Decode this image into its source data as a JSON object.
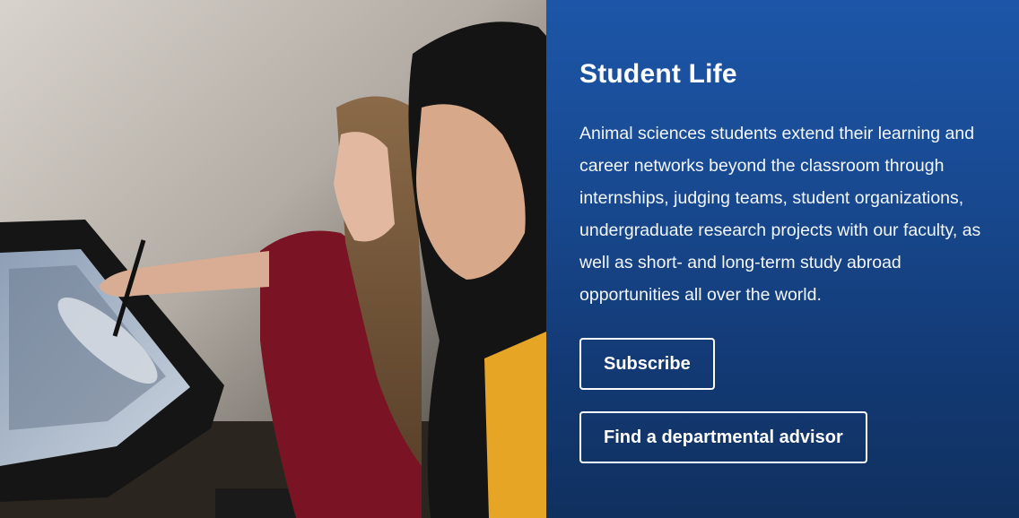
{
  "photo": {
    "alt": "Two students examining an image on a large drawing tablet display"
  },
  "panel": {
    "title": "Student Life",
    "description": "Animal sciences students extend their learning and career networks beyond the classroom through internships, judging teams, student organizations, undergraduate research projects with our faculty, as well as short- and long-term study abroad opportunities all over the world.",
    "buttons": {
      "subscribe_label": "Subscribe",
      "advisor_label": "Find a departmental advisor"
    }
  },
  "colors": {
    "panel_top": "#1d56a8",
    "panel_bottom": "#10305f",
    "text": "#ffffff"
  }
}
